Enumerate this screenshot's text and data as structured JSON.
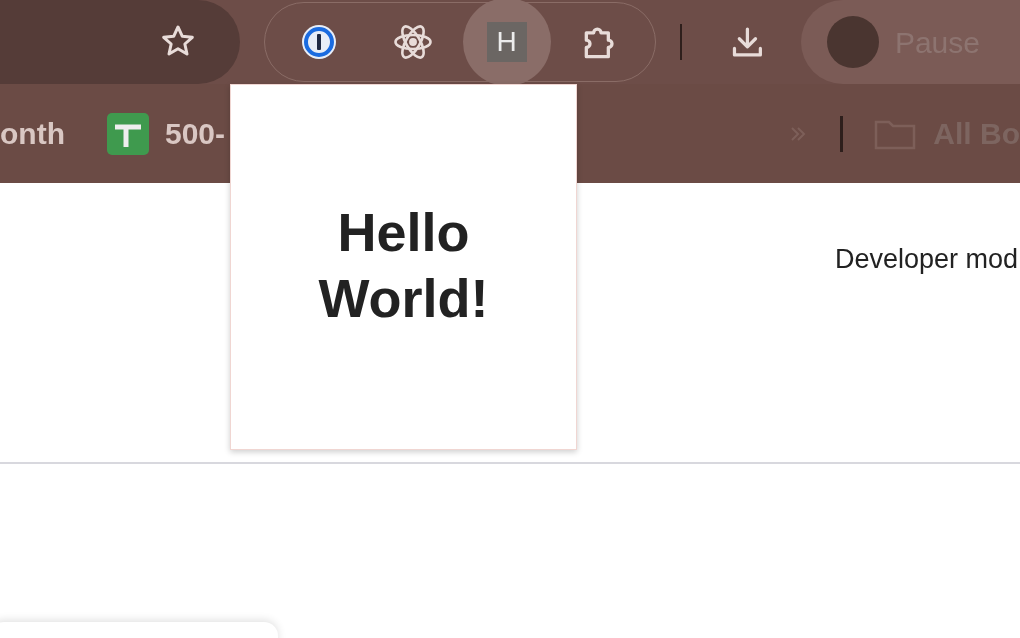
{
  "toolbar": {
    "extensions": [
      {
        "kind": "password",
        "selected": false
      },
      {
        "kind": "atom",
        "selected": false
      },
      {
        "kind": "letter",
        "label": "H",
        "selected": true
      },
      {
        "kind": "puzzle",
        "selected": false
      }
    ],
    "profile": {
      "label": "Pause"
    }
  },
  "bookmarks": {
    "items": [
      {
        "kind": "plain",
        "label": "onth"
      },
      {
        "kind": "sheet",
        "label": "500-"
      }
    ],
    "all_bookmarks": "All Bo"
  },
  "popup": {
    "heading": "Hello World!"
  },
  "page": {
    "developer_mode": "Developer mod"
  }
}
